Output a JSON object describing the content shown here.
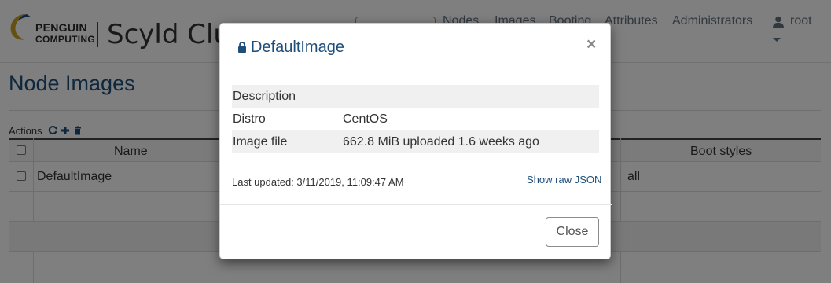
{
  "brand": {
    "logo_line1": "PENGUIN",
    "logo_line2": "COMPUTING",
    "product": "Scyld Clus",
    "accent_color": "#1f4e79"
  },
  "nav": {
    "search_placeholder": "",
    "items": [
      {
        "label": "Nodes"
      },
      {
        "label": "Images"
      },
      {
        "label": "Booting"
      },
      {
        "label": "Attributes"
      },
      {
        "label": "Administrators"
      }
    ],
    "user": {
      "label": "root",
      "icon": "user-icon"
    }
  },
  "page": {
    "title": "Node Images",
    "actions": {
      "label": "Actions",
      "icons": [
        "refresh-icon",
        "plus-icon",
        "trash-icon"
      ]
    }
  },
  "table": {
    "columns": [
      "Name",
      "Boot styles"
    ],
    "rows": [
      {
        "name": "DefaultImage",
        "boot_styles": "all"
      }
    ]
  },
  "modal": {
    "title": "DefaultImage",
    "title_icon": "lock-icon",
    "close_symbol": "×",
    "fields": [
      {
        "key": "Description",
        "value": ""
      },
      {
        "key": "Distro",
        "value": "CentOS"
      },
      {
        "key": "Image file",
        "value": "662.8 MiB uploaded 1.6 weeks ago"
      }
    ],
    "last_updated": "Last updated: 3/11/2019, 11:09:47 AM",
    "raw_json_link": "Show raw JSON",
    "close_button": "Close"
  }
}
